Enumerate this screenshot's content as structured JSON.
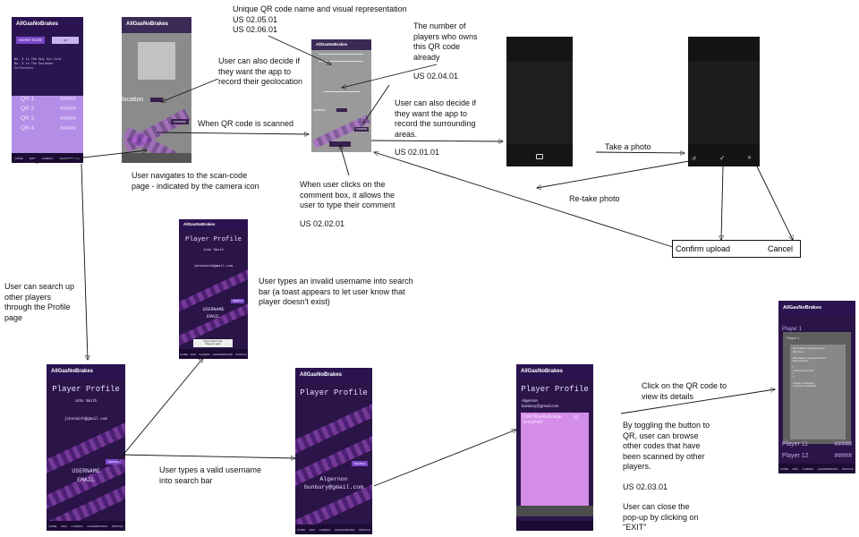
{
  "app_name": "AllGasNoBrakes",
  "notes": {
    "qr_name": "Unique QR code name and visual representation\nUS 02.05.01\nUS 02.06.01",
    "players_own": "The number of\nplayers who owns\nthis QR code\nalready",
    "us_02_04_01": "US 02.04.01",
    "geolocation": "User can also decide if\nthey want the app to\nrecord their geolocation",
    "when_scanned": "When QR code is scanned",
    "surrounding": "User can also decide if\nthey want the app to\nrecord the surrounding\nareas.",
    "us_02_01_01": "US 02.01.01",
    "take_photo": "Take a photo",
    "retake_photo": "Re-take photo",
    "navigate": "User navigates to the scan-code\npage - indicated by the camera icon",
    "comment": "When user clicks on the\ncomment box, it allows the\nuser to type their comment",
    "us_02_02_01": "US 02.02.01",
    "search_up": "User can search up\nother players\nthrough the Profile\npage",
    "invalid": "User types an invalid username into search\nbar (a toast appears to let user know that\nplayer doesn't exist)",
    "valid": "User types a valid username\ninto search bar",
    "click_qr": "Click on the QR code to\nview its details",
    "toggle": "By toggling the button to\nQR, user can browse\nother codes that have\nbeen scanned by other\nplayers.",
    "us_02_03_01": "US 02.03.01",
    "close_popup": "User can close the\npop-up by clicking on\n\"EXIT\""
  },
  "confirm_box": {
    "confirm": "Confirm upload",
    "cancel": "Cancel"
  },
  "phone1": {
    "buttons": [
      "HIGHEST SCORE",
      "QR"
    ],
    "info": "No. X is The Guy Xxx Cola\nNo. X is The Gardener\nCollectors",
    "rows": [
      {
        "label": "QR 1",
        "value": "#####"
      },
      {
        "label": "QR 2",
        "value": "#####"
      },
      {
        "label": "QR 3",
        "value": "#####"
      },
      {
        "label": "QR 4",
        "value": "#####"
      }
    ]
  },
  "phone2": {
    "location": "location",
    "confirm": "CONFIRM"
  },
  "phone3": {
    "location": "location",
    "confirm": "CONFIRM"
  },
  "profile": {
    "title": "Player Profile",
    "name": "John Smith",
    "email": "johnsmith@gmail.com",
    "username_label": "USERNAME",
    "email_label": "EMAIL",
    "search": "SEARCH",
    "found_name": "Algernon",
    "found_email": "bunbury@gmail.com",
    "toast": "Player doesn't exist\nPlease try again"
  },
  "profile_list": {
    "name": "Algernon",
    "email": "bunbury@gmail.com",
    "item": "Cold BlueRedLarge\nScaryFish",
    "item_score": "32"
  },
  "leaderboard": {
    "popup_title": "Player 1",
    "popup_lines": "QR: Random Generated Name\nQR: Score\n\nWith Random Generated Visual\nRepresentation\n\n1\nComments and stuff\n2\n3\n\nLatitude Coordinates\nLongitude Coordinates",
    "rows": [
      {
        "label": "Player 1",
        "value": ""
      },
      {
        "label": "Player 11",
        "value": "#####"
      },
      {
        "label": "Player 12",
        "value": "#####"
      }
    ]
  },
  "nav": [
    "HOME",
    "MAP",
    "CAMERA",
    "LEADERBOARD",
    "PROFILE"
  ]
}
